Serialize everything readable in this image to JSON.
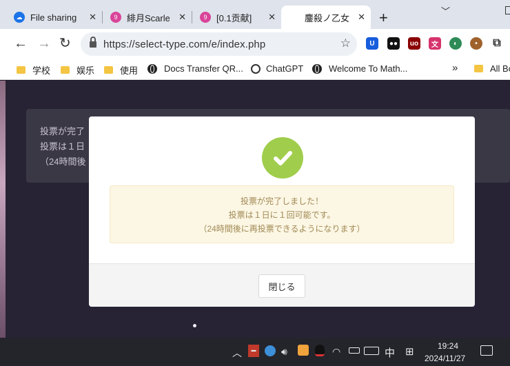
{
  "browser": {
    "tabs": [
      {
        "title": "File sharing",
        "favicon": "cloud-icon"
      },
      {
        "title": "緋月Scarlet",
        "favicon": "pink-circle-icon"
      },
      {
        "title": "[0.1贡献]",
        "favicon": "pink-circle-icon"
      },
      {
        "title": "鏖殺ノ乙女",
        "favicon": "page-icon",
        "active": true
      }
    ],
    "new_tab": "+",
    "url": "https://select-type.com/e/index.php",
    "bookmarks": [
      {
        "label": "学校",
        "icon": "folder-icon"
      },
      {
        "label": "娱乐",
        "icon": "folder-icon"
      },
      {
        "label": "使用",
        "icon": "folder-icon"
      },
      {
        "label": "Docs Transfer QR...",
        "icon": "globe-icon"
      },
      {
        "label": "ChatGPT",
        "icon": "chatgpt-icon"
      },
      {
        "label": "Welcome To Math...",
        "icon": "globe-icon"
      },
      {
        "label": "All Bo",
        "icon": "folder-icon"
      }
    ],
    "bookmarks_overflow": "»"
  },
  "page": {
    "bg_lines": [
      "投票が完了",
      "投票は１日",
      "（24時間後"
    ]
  },
  "modal": {
    "lines": [
      "投票が完了しました！",
      "投票は１日に１回可能です。",
      "（24時間後に再投票できるようになります）"
    ],
    "close_label": "閉じる"
  },
  "taskbar": {
    "ime": "中",
    "time": "19:24",
    "date": "2024/11/27"
  },
  "colors": {
    "success": "#a0cd4c",
    "alert_bg": "#fcf6e4",
    "alert_text": "#a08a55"
  }
}
